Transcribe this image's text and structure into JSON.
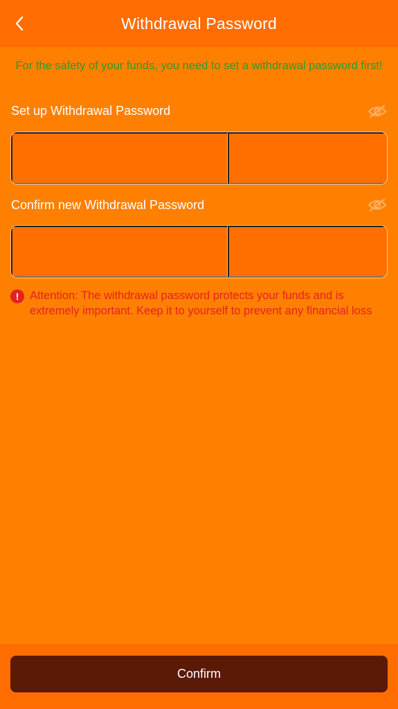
{
  "header": {
    "title": "Withdrawal Password",
    "back_icon": "chevron-left-icon"
  },
  "notice": "For the safety of your funds, you need to set a withdrawal password first!",
  "setup": {
    "label": "Set up Withdrawal Password",
    "visibility_icon": "eye-off-icon",
    "digits": [
      "",
      "",
      "",
      "",
      "",
      ""
    ]
  },
  "confirm_field": {
    "label": "Confirm new Withdrawal Password",
    "visibility_icon": "eye-off-icon",
    "digits": [
      "",
      "",
      "",
      "",
      "",
      ""
    ]
  },
  "attention": {
    "icon": "alert-icon",
    "text": "Attention: The withdrawal password protects your funds and is extremely important. Keep it to yourself to prevent any financial loss"
  },
  "footer": {
    "confirm_label": "Confirm"
  },
  "colors": {
    "background": "#ff8000",
    "header": "#ff6d00",
    "notice_text": "#2e9a2a",
    "warning_text": "#e8201e",
    "button": "#5a1a06"
  }
}
